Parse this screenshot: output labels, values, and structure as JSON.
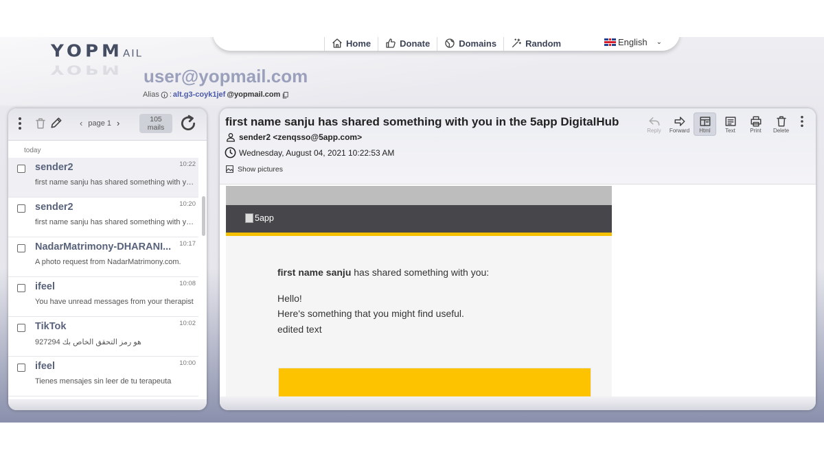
{
  "logo": {
    "text_main": "YOPM",
    "text_small": "AIL"
  },
  "nav": {
    "items": [
      {
        "label": "Home",
        "icon": "home-icon"
      },
      {
        "label": "Donate",
        "icon": "thumbs-up-icon"
      },
      {
        "label": "Domains",
        "icon": "globe-icon"
      },
      {
        "label": "Random",
        "icon": "magic-wand-icon"
      }
    ],
    "language": "English"
  },
  "inbox_address": "user@yopmail.com",
  "alias": {
    "label": "Alias",
    "separator": ":",
    "value": "alt.g3-coyk1jef",
    "domain": "@yopmail.com"
  },
  "inbox": {
    "pager": "page 1",
    "count_number": "105",
    "count_label": "mails",
    "day_label": "today",
    "mails": [
      {
        "from": "sender2",
        "time": "10:22",
        "subject": "first name sanju has shared something with you in the 5app DigitalHub"
      },
      {
        "from": "sender2",
        "time": "10:20",
        "subject": "first name sanju has shared something with you in the 5app DigitalHub"
      },
      {
        "from": "NadarMatrimony-DHARANI...",
        "time": "10:17",
        "subject": "A photo request from NadarMatrimony.com."
      },
      {
        "from": "ifeel",
        "time": "10:08",
        "subject": "You have unread messages from your therapist"
      },
      {
        "from": "TikTok",
        "time": "10:02",
        "subject": "927294 هو رمز التحقق الخاص بك"
      },
      {
        "from": "ifeel",
        "time": "10:00",
        "subject": "Tienes mensajes sin leer de tu terapeuta"
      }
    ]
  },
  "message": {
    "subject": "first name sanju has shared something with you in the 5app DigitalHub",
    "from": "sender2 <zenqsso@5app.com>",
    "date": "Wednesday, August 04, 2021 10:22:53 AM",
    "show_pictures": "Show pictures",
    "actions": {
      "reply": "Reply",
      "forward": "Forward",
      "html": "Html",
      "text": "Text",
      "print": "Print",
      "delete": "Delete"
    },
    "body": {
      "image_alt": "5app",
      "sharer": "first name sanju",
      "shared_text": "has shared something with you:",
      "line1": "Hello!",
      "line2": "Here's something that you might find useful.",
      "line3": "edited text"
    }
  },
  "colors": {
    "accent_yellow": "#fdc200",
    "header_dark": "#47474b",
    "address_color": "#9aa0bb"
  }
}
